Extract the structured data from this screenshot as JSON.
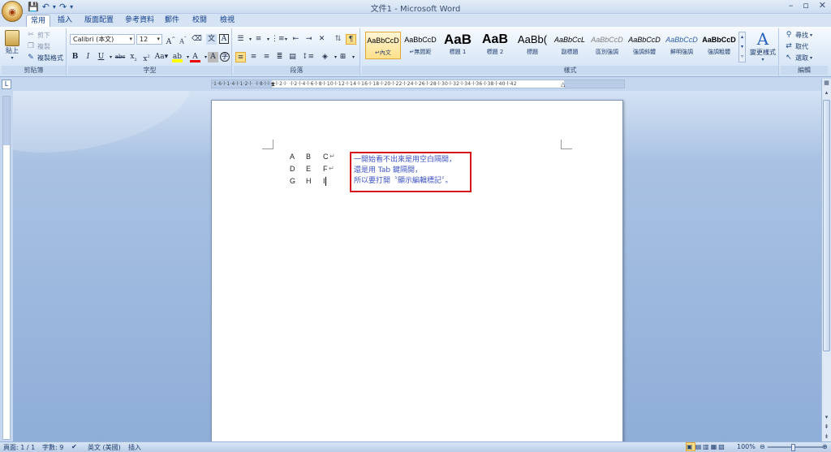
{
  "window": {
    "title": "文件1 - Microsoft Word",
    "controls": [
      "–",
      "▫",
      "✕"
    ]
  },
  "quick_access": [
    "💾",
    "↶",
    "▾",
    "↷",
    "▾"
  ],
  "tabs": [
    "常用",
    "插入",
    "版面配置",
    "參考資料",
    "郵件",
    "校閱",
    "檢視"
  ],
  "active_tab": "常用",
  "ribbon": {
    "clipboard": {
      "paste": "貼上",
      "cut": "剪下",
      "copy": "複製",
      "format_painter": "複製格式",
      "label": "剪貼簿"
    },
    "font": {
      "family": "Calibri (本文)",
      "size": "12",
      "label": "字型"
    },
    "paragraph": {
      "label": "段落"
    },
    "styles": {
      "items": [
        {
          "sample": "AaBbCcD",
          "name": "↵內文"
        },
        {
          "sample": "AaBbCcD",
          "name": "↵無間距"
        },
        {
          "sample": "AaB",
          "name": "標題 1"
        },
        {
          "sample": "AaB",
          "name": "標題 2"
        },
        {
          "sample": "AaBb(",
          "name": "標題"
        },
        {
          "sample": "AaBbCcL",
          "name": "副標題"
        },
        {
          "sample": "AaBbCcD",
          "name": "區別強調"
        },
        {
          "sample": "AaBbCcD",
          "name": "強調斜體"
        },
        {
          "sample": "AaBbCcD",
          "name": "鮮明強調"
        },
        {
          "sample": "AaBbCcD",
          "name": "強調粗體"
        }
      ],
      "change_styles": "變更樣式",
      "label": "樣式"
    },
    "editing": {
      "find": "尋找",
      "replace": "取代",
      "select": "選取",
      "label": "編輯"
    }
  },
  "ruler": {
    "text": "·1·6·l·1·4·l·1·2·l· ·l·8·l·l·4·l·2·l· ·l·2·l·4·l·6·l·8·l·10·l·12·l·14·l·16·l·18·l·20·l·22·l·24·l·26·l·28·l·30·l·32·l·34·l·36·l·38·l·40·l·42"
  },
  "document": {
    "rows": [
      {
        "a": "A",
        "b": "B",
        "c": "C",
        "mark": "↵"
      },
      {
        "a": "D",
        "b": "E",
        "c": "F",
        "mark": "↵"
      },
      {
        "a": "G",
        "b": "H",
        "c": "I",
        "mark": ""
      }
    ],
    "callout": {
      "line1": "一開始看不出來是用空白隔開，",
      "line2": "還是用 Tab 鍵隔開，",
      "line3": "所以要打開〝顯示編輯標記〞。"
    }
  },
  "status": {
    "page": "頁面: 1 / 1",
    "words": "字數: 9",
    "language": "英文 (美國)",
    "mode": "插入",
    "zoom": "100%"
  },
  "colors": {
    "callout_border": "#d6141c",
    "callout_text": "#3f56c3",
    "ribbon_accent": "#15428b"
  }
}
